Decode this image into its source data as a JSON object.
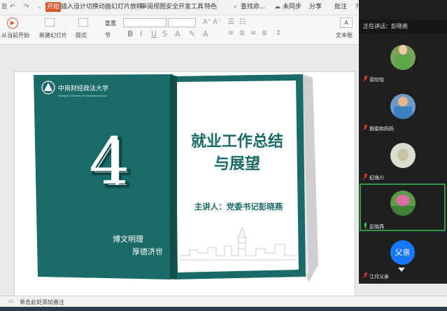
{
  "ribbon": {
    "tabs": [
      "开始",
      "插入",
      "设计",
      "切换",
      "动画",
      "幻灯片放映",
      "审阅",
      "视图",
      "安全",
      "开发工具",
      "特色"
    ],
    "active_tab": "开始",
    "search_label": "查找命...",
    "sync_label": "未同步",
    "share_label": "分享",
    "comment_label": "批注",
    "help_label": "?",
    "from_current": "从当前开始",
    "new_slide": "新建幻灯片",
    "layout": "版式",
    "section": "节",
    "reset": "重置",
    "textbox": "文本框"
  },
  "slide": {
    "university_cn": "中南财经政法大学",
    "university_en": "Zhongnan University of Economics and Law",
    "number": "4",
    "title_line1": "就业工作总结",
    "title_line2": "与展望",
    "speaker": "主讲人：党委书记彭晓燕",
    "motto1": "博文明理",
    "motto2": "厚德济世"
  },
  "panel": {
    "speaking_label": "正在讲话：彭晓燕",
    "participants": [
      {
        "name": "梁欣怡",
        "muted": true
      },
      {
        "name": "姚俊和妈妈",
        "muted": true
      },
      {
        "name": "纪逸川",
        "muted": true
      },
      {
        "name": "彭晓燕",
        "muted": false,
        "speaking": true
      },
      {
        "name": "江月父亲",
        "muted": true,
        "initials": "父亲"
      }
    ]
  },
  "status": {
    "notes_placeholder": "单击此处添加备注"
  },
  "colors": {
    "accent": "#d9572b",
    "teal": "#1a6b67",
    "speaker_border": "#2d9b4a",
    "avatar_blue": "#1677ff"
  }
}
